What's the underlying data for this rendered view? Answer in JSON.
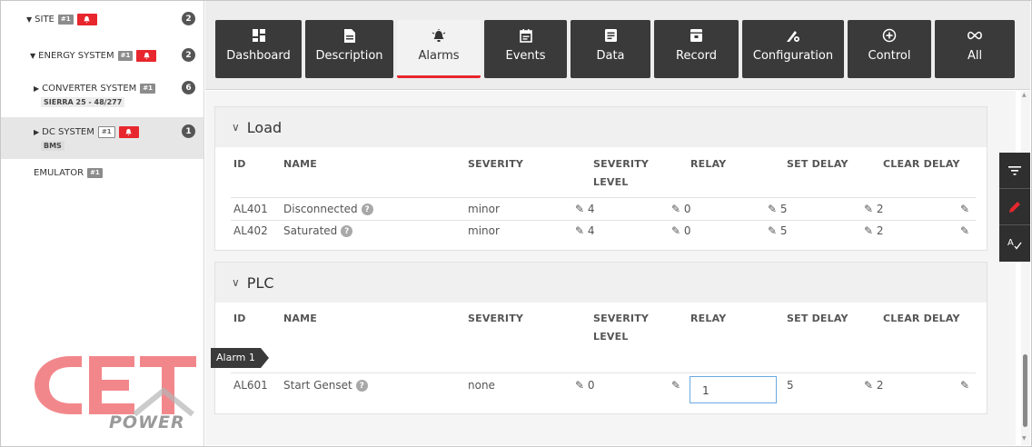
{
  "sidebar": {
    "site": {
      "label": "SITE",
      "tag": "#1",
      "count": "2"
    },
    "energy_system": {
      "label": "ENERGY SYSTEM",
      "tag": "#1",
      "count": "2"
    },
    "converter_system": {
      "label": "CONVERTER SYSTEM",
      "tag": "#1",
      "sub": "SIERRA 25 - 48/277",
      "count": "6"
    },
    "dc_system": {
      "label": "DC SYSTEM",
      "tag": "#1",
      "sub": "BMS",
      "count": "1"
    },
    "emulator": {
      "label": "EMULATOR",
      "tag": "#1"
    },
    "logo_text": "POWER"
  },
  "tabs": [
    {
      "label": "Dashboard",
      "icon": "dashboard-icon"
    },
    {
      "label": "Description",
      "icon": "document-icon"
    },
    {
      "label": "Alarms",
      "icon": "alarm-icon"
    },
    {
      "label": "Events",
      "icon": "calendar-icon"
    },
    {
      "label": "Data",
      "icon": "data-icon"
    },
    {
      "label": "Record",
      "icon": "record-icon"
    },
    {
      "label": "Configuration",
      "icon": "configuration-icon"
    },
    {
      "label": "Control",
      "icon": "control-icon"
    },
    {
      "label": "All",
      "icon": "infinity-icon"
    }
  ],
  "active_tab": "Alarms",
  "columns": {
    "id": "ID",
    "name": "NAME",
    "severity": "SEVERITY",
    "severity_level_1": "SEVERITY",
    "severity_level_2": "LEVEL",
    "relay": "RELAY",
    "set_delay": "SET DELAY",
    "clear_delay": "CLEAR DELAY"
  },
  "load": {
    "title": "Load",
    "rows": [
      {
        "id": "AL401",
        "name": "Disconnected",
        "severity": "minor",
        "level": "4",
        "relay": "0",
        "set_delay": "5",
        "clear_delay": "2"
      },
      {
        "id": "AL402",
        "name": "Saturated",
        "severity": "minor",
        "level": "4",
        "relay": "0",
        "set_delay": "5",
        "clear_delay": "2"
      }
    ]
  },
  "plc": {
    "title": "PLC",
    "rows": [
      {
        "id": "AL601",
        "name": "Start Genset",
        "severity": "none",
        "level": "0",
        "relay": "1",
        "set_delay": "5",
        "clear_delay": "2"
      }
    ]
  },
  "tooltip": "Alarm 1",
  "colors": {
    "accent": "#e8262d",
    "tab_bg": "#3a3a3a",
    "input_border": "#6aa9e0"
  }
}
